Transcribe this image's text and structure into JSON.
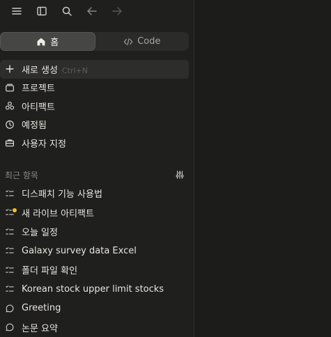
{
  "toolbar": {
    "icons": [
      "menu-icon",
      "sidebar-toggle-icon",
      "search-icon",
      "arrow-left-icon",
      "arrow-right-icon"
    ]
  },
  "mode_switch": {
    "tabs": [
      {
        "label": "홈",
        "icon": "home-icon",
        "active": true
      },
      {
        "label": "Code",
        "icon": "code-icon",
        "active": false
      }
    ]
  },
  "menu": {
    "items": [
      {
        "label": "새로 생성",
        "shortcut": "Ctrl+N",
        "icon": "plus-icon"
      },
      {
        "label": "프로젝트",
        "icon": "folder-icon"
      },
      {
        "label": "아티팩트",
        "icon": "artifact-icon"
      },
      {
        "label": "예정됨",
        "icon": "clock-icon"
      },
      {
        "label": "사용자 지정",
        "icon": "briefcase-icon"
      }
    ]
  },
  "recent": {
    "title": "최근 항목",
    "items": [
      {
        "label": "디스패치 기능 사용법",
        "icon": "task-list-icon"
      },
      {
        "label": "새 라이브 아티팩트",
        "icon": "task-list-icon",
        "badge_color": "#f2c318"
      },
      {
        "label": "오늘 일정",
        "icon": "task-list-icon"
      },
      {
        "label": "Galaxy survey data Excel",
        "icon": "task-list-icon"
      },
      {
        "label": "폴더 파일 확인",
        "icon": "task-list-icon"
      },
      {
        "label": "Korean stock upper limit stocks",
        "icon": "task-list-icon"
      },
      {
        "label": "Greeting",
        "icon": "chat-bubble-icon"
      },
      {
        "label": "논문 요약",
        "icon": "chat-bubble-icon"
      }
    ]
  },
  "colors": {
    "background": "#1c1c1b",
    "sidebar": "#1f1f1e",
    "active_tab": "#464644",
    "badge": "#f2c318"
  }
}
